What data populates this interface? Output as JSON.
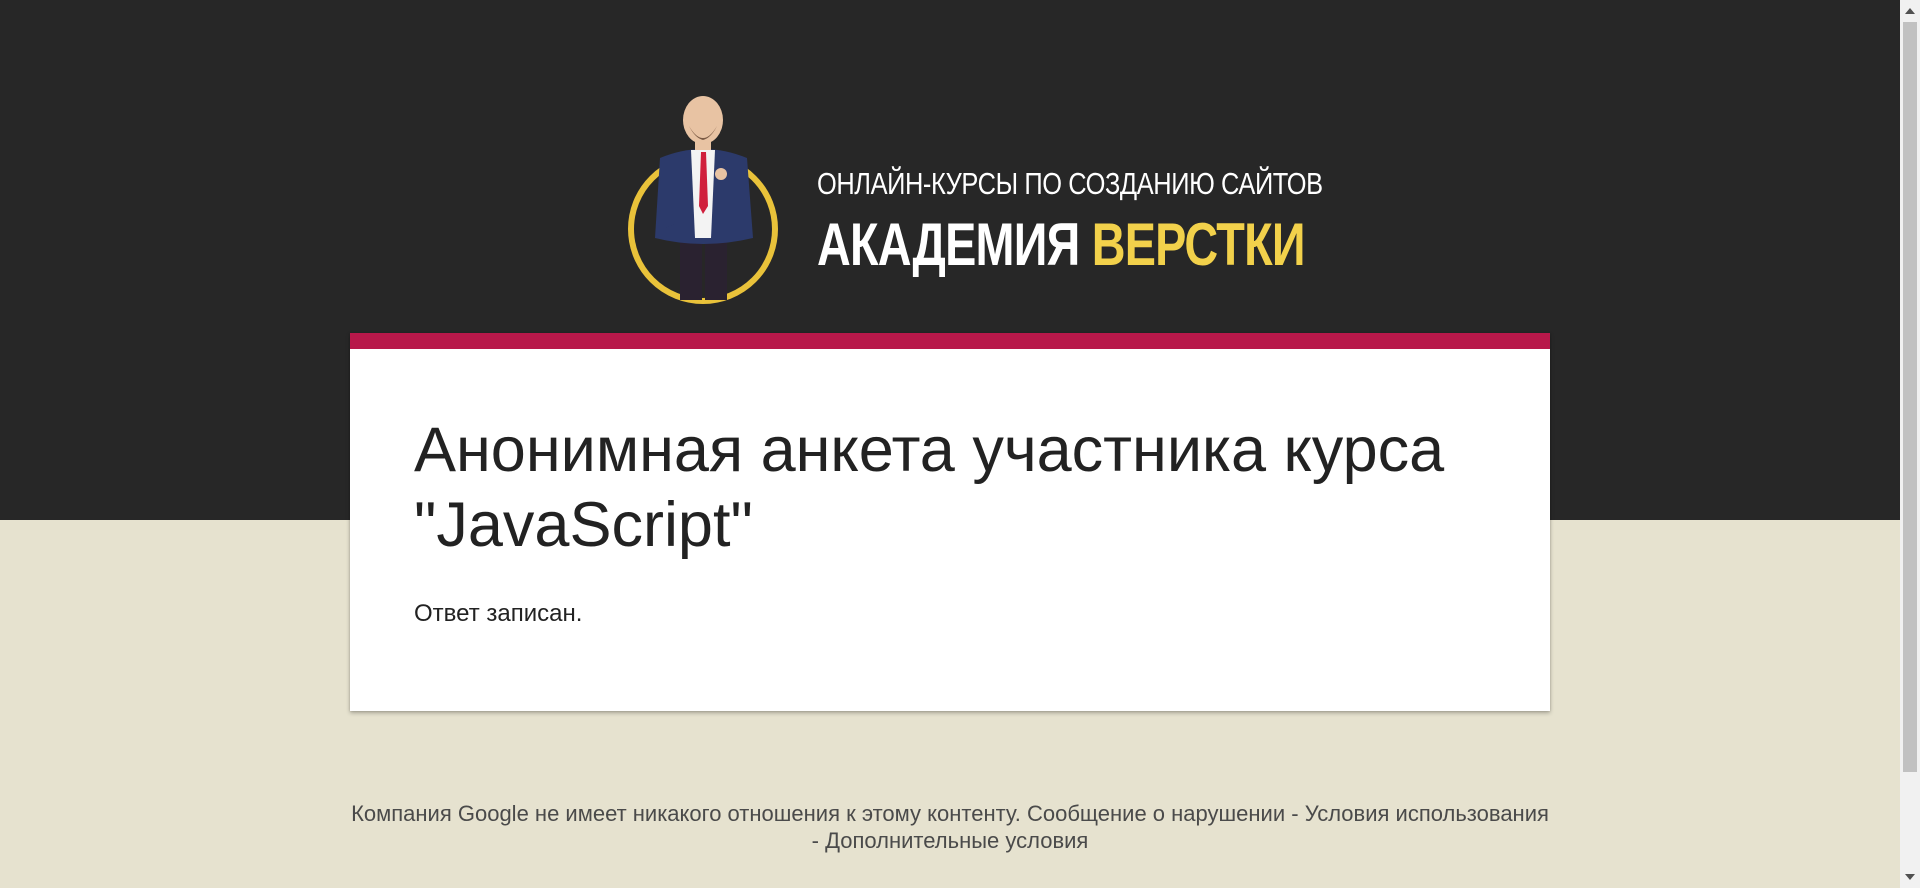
{
  "header": {
    "logo": {
      "tagline": "ОНЛАЙН-КУРСЫ ПО СОЗДАНИЮ САЙТОВ",
      "brand_main": "АКАДЕМИЯ",
      "brand_accent": "ВЕРСТКИ",
      "ring_color": "#e9c23a",
      "accent_color": "#f2d14b"
    },
    "background_color": "#272727"
  },
  "form": {
    "title_line1": "Анонимная анкета участника курса",
    "title_line2": "\"JavaScript\"",
    "response_message": "Ответ записан.",
    "accent_color": "#b8184a"
  },
  "footer": {
    "disclaimer": "Компания Google не имеет никакого отношения к этому контенту.",
    "report_link": "Сообщение о нарушении",
    "separator": "-",
    "terms_link": "Условия использования",
    "additional_terms_link": "Дополнительные условия"
  },
  "page": {
    "background_color": "#e6e2cf"
  }
}
